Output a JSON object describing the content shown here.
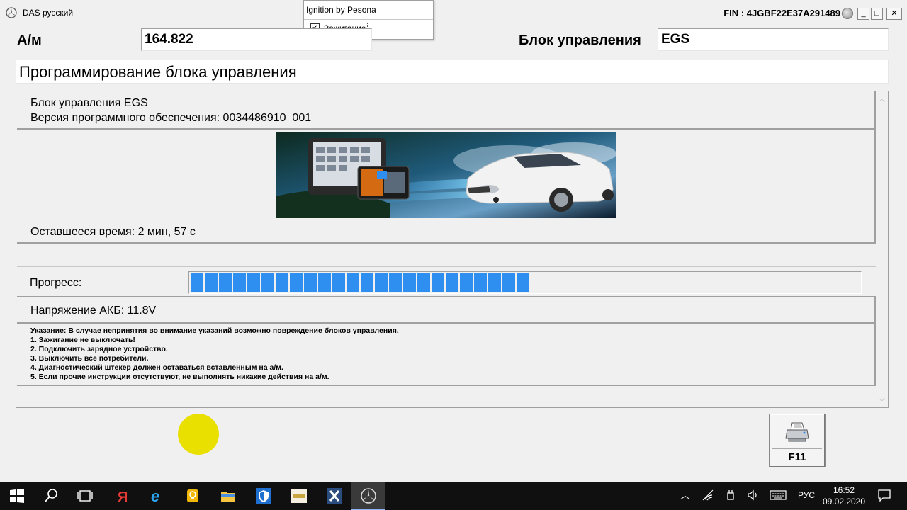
{
  "window": {
    "title": "DAS русский",
    "fin": "FIN : 4JGBF22E37A291489",
    "controls": {
      "minimize": "_",
      "maximize": "□",
      "close": "✕"
    }
  },
  "popup": {
    "title": "Ignition by Pesona",
    "checkbox_label": "Зажигание",
    "checkbox_checked": true,
    "check_mark": "✔"
  },
  "header": {
    "vehicle_label": "А/м",
    "vehicle_value": "164.822",
    "control_unit_label": "Блок управления",
    "control_unit_value": "EGS",
    "operation_title": "Программирование блока управления"
  },
  "panel": {
    "unit_line": "Блок управления EGS",
    "software_line": "Версия программного обеспечения: 0034486910_001",
    "remaining_time": "Оставшееся время: 2 мин, 57 с",
    "progress_label": "Прогресс:",
    "progress_fraction": 0.505,
    "battery_voltage": "Напряжение АКБ: 11.8V",
    "notice": [
      "Указание:  В случае непринятия во внимание указаний возможно повреждение блоков управления.",
      "1. Зажигание не выключать!",
      "2. Подключить зарядное устройство.",
      "3. Выключить все потребители.",
      "4. Диагностический штекер должен оставаться вставленным на а/м.",
      "5. Если прочие инструкции отсутствуют, не выполнять никакие действия на а/м."
    ],
    "scroll_up": "︿",
    "scroll_down": "﹀"
  },
  "actions": {
    "print_button_label": "F11",
    "print_icon": "printer-icon"
  },
  "taskbar": {
    "icons": [
      "windows-start-icon",
      "search-icon",
      "task-view-icon",
      "yandex-icon",
      "internet-explorer-icon",
      "lightbulb-icon",
      "file-explorer-icon",
      "security-shield-icon",
      "app-icon",
      "xentry-icon",
      "mercedes-das-icon"
    ],
    "language": "РУС",
    "time": "16:52",
    "date": "09.02.2020",
    "tray_chevron": "︿"
  },
  "colors": {
    "progress_blue": "#2e8ff0",
    "indicator_yellow": "#e9e000",
    "taskbar": "#101010"
  }
}
